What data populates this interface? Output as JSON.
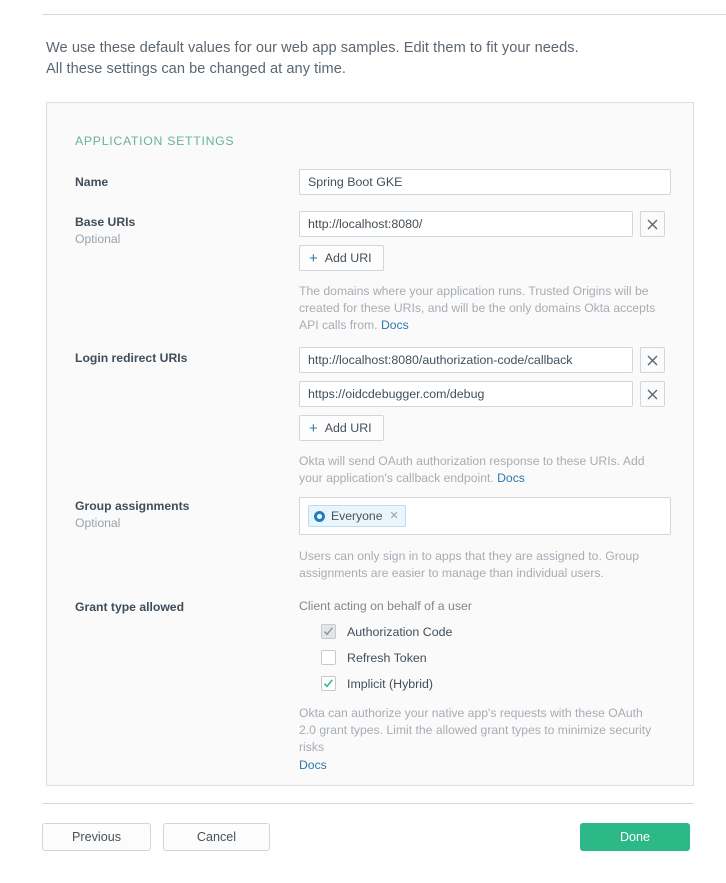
{
  "intro": {
    "line1": "We use these default values for our web app samples. Edit them to fit your needs.",
    "line2": "All these settings can be changed at any time."
  },
  "card": {
    "title": "APPLICATION SETTINGS"
  },
  "name_row": {
    "label": "Name",
    "value": "Spring Boot GKE",
    "placeholder": ""
  },
  "base_uris": {
    "label": "Base URIs",
    "optional": "Optional",
    "uris": [
      {
        "value": "http://localhost:8080/"
      }
    ],
    "add_label": "Add URI",
    "add_icon": "plus-icon",
    "remove_icon": "close-icon",
    "helper": "The domains where your application runs. Trusted Origins will be created for these URIs, and will be the only domains Okta accepts API calls from. ",
    "helper_link": "Docs"
  },
  "login_redirect": {
    "label": "Login redirect URIs",
    "uris": [
      {
        "value": "http://localhost:8080/authorization-code/callback"
      },
      {
        "value": "https://oidcdebugger.com/debug"
      }
    ],
    "add_label": "Add URI",
    "add_icon": "plus-icon",
    "remove_icon": "close-icon",
    "helper": "Okta will send OAuth authorization response to these URIs. Add your application's callback endpoint. ",
    "helper_link": "Docs"
  },
  "group_assignments": {
    "label": "Group assignments",
    "optional": "Optional",
    "chips": [
      {
        "label": "Everyone",
        "icon": "group-circle-icon",
        "remove_icon": "chip-close-icon"
      }
    ],
    "helper": "Users can only sign in to apps that they are assigned to. Group assignments are easier to manage than individual users."
  },
  "grant_type": {
    "label": "Grant type allowed",
    "section_label": "Client acting on behalf of a user",
    "options": [
      {
        "label": "Authorization Code",
        "checked": true,
        "disabled": true
      },
      {
        "label": "Refresh Token",
        "checked": false,
        "disabled": false
      },
      {
        "label": "Implicit (Hybrid)",
        "checked": true,
        "disabled": false
      }
    ],
    "helper": "Okta can authorize your native app's requests with these OAuth 2.0 grant types. Limit the allowed grant types to minimize security risks",
    "helper_link": "Docs"
  },
  "footer": {
    "previous": "Previous",
    "cancel": "Cancel",
    "done": "Done"
  },
  "colors": {
    "accent_green": "#2cb887",
    "heading_green": "#68b39b",
    "link_blue": "#2a7ab0",
    "chip_blue": "#1f7fc4"
  }
}
